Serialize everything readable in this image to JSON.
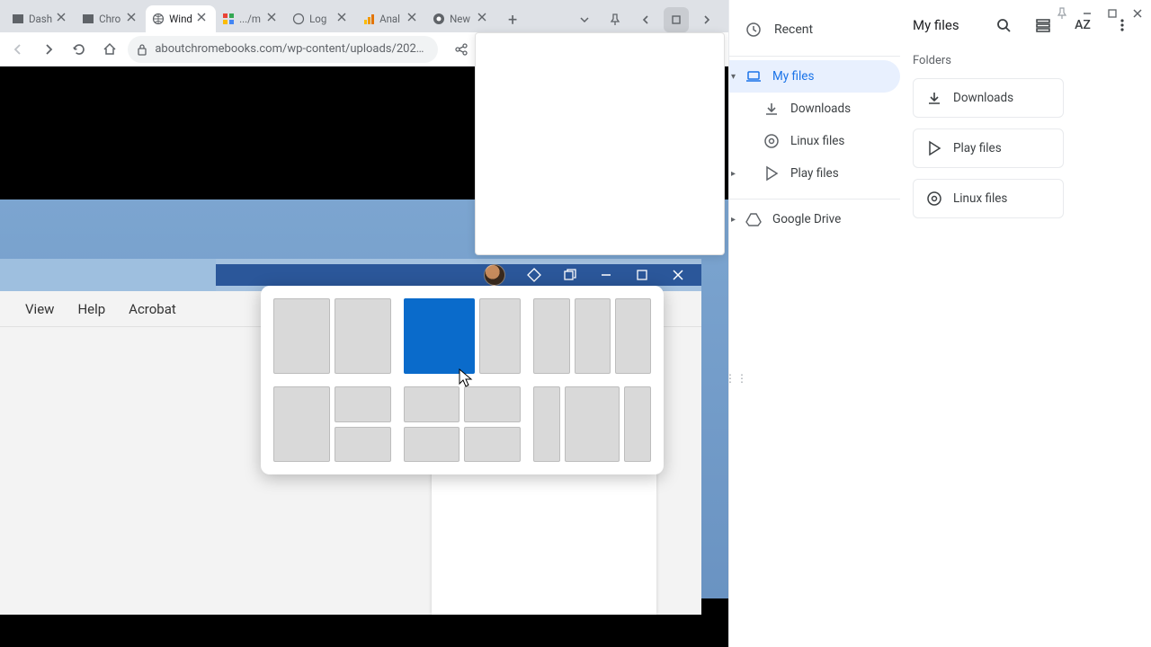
{
  "chrome": {
    "tabs": [
      {
        "title": "Dash",
        "fav": "square"
      },
      {
        "title": "Chro",
        "fav": "square"
      },
      {
        "title": "Wind",
        "fav": "globe",
        "active": true
      },
      {
        "title": ".../m",
        "fav": "grid"
      },
      {
        "title": "Log",
        "fav": "globe"
      },
      {
        "title": "Anal",
        "fav": "analytics"
      },
      {
        "title": "New",
        "fav": "chrome"
      }
    ],
    "url": "aboutchromebooks.com/wp-content/uploads/2022/0…"
  },
  "word": {
    "menu": {
      "view": "View",
      "help": "Help",
      "acrobat": "Acrobat"
    }
  },
  "files": {
    "header_title": "My files",
    "sort_label": "AZ",
    "sidebar": {
      "recent": "Recent",
      "my_files": "My files",
      "downloads": "Downloads",
      "linux": "Linux files",
      "play": "Play files",
      "drive": "Google Drive"
    },
    "section": "Folders",
    "folders": {
      "downloads": "Downloads",
      "play": "Play files",
      "linux": "Linux files"
    }
  }
}
